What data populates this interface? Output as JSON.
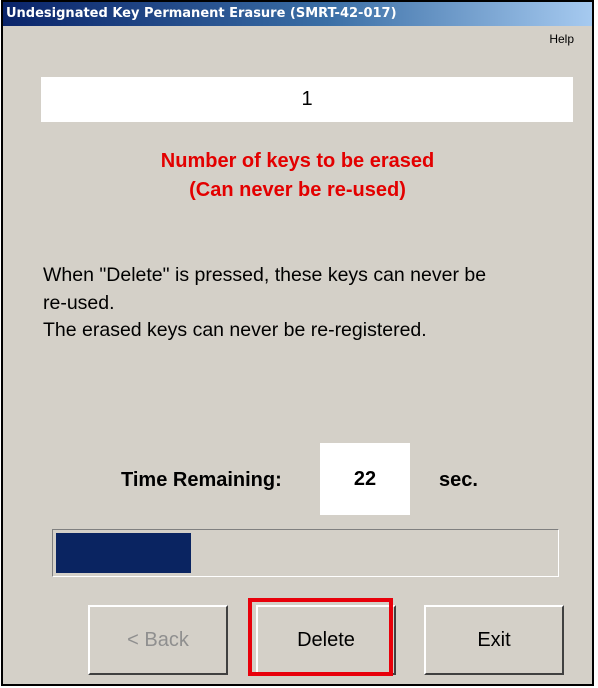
{
  "window": {
    "title": "Undesignated Key Permanent Erasure (SMRT-42-017)"
  },
  "menu": {
    "help_label": "Help"
  },
  "key_count": {
    "value": "1"
  },
  "warning": {
    "line1": "Number of keys to be erased",
    "line2": "(Can never be re-used)",
    "color": "#e30000"
  },
  "instructions": {
    "line1": "When \"Delete\" is pressed, these keys can never be",
    "line2": "re-used.",
    "line3": "The erased keys can never be re-registered."
  },
  "timer": {
    "label": "Time Remaining:",
    "value": "22",
    "unit": "sec."
  },
  "progress": {
    "fraction": 0.27,
    "fill_color": "#0a2461"
  },
  "buttons": {
    "back_label": "< Back",
    "back_enabled": false,
    "delete_label": "Delete",
    "exit_label": "Exit"
  },
  "annotation": {
    "highlight_color": "#e8000b",
    "highlighted_element": "delete-button"
  }
}
